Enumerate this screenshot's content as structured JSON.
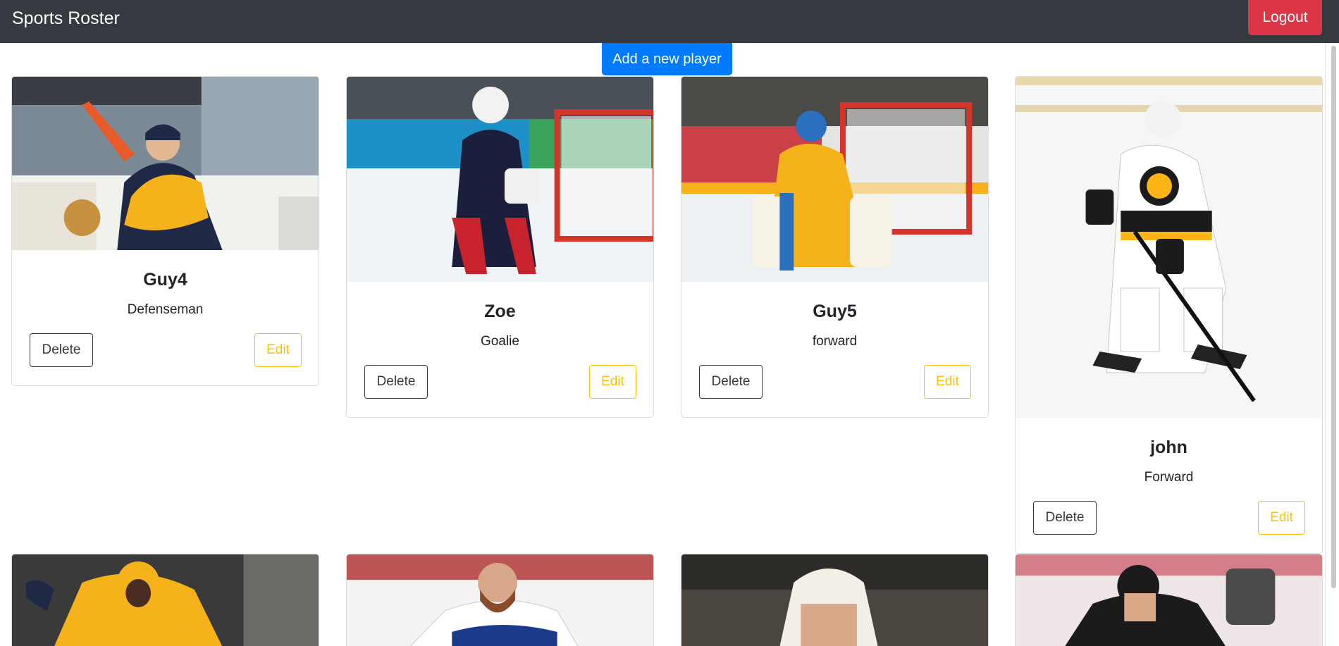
{
  "navbar": {
    "brand": "Sports Roster",
    "logout_label": "Logout"
  },
  "actions": {
    "add_player_label": "Add a new player"
  },
  "buttons": {
    "delete_label": "Delete",
    "edit_label": "Edit"
  },
  "players": [
    {
      "name": "Guy4",
      "position": "Defenseman"
    },
    {
      "name": "Zoe",
      "position": "Goalie"
    },
    {
      "name": "Guy5",
      "position": "forward"
    },
    {
      "name": "john",
      "position": "Forward"
    }
  ],
  "colors": {
    "navbar": "#343a40",
    "primary": "#007bff",
    "danger": "#dc3545",
    "warning": "#ffc107",
    "predators_gold": "#f5b21b",
    "usa_navy": "#1b1f3b",
    "bruins_gold": "#fcb514"
  }
}
